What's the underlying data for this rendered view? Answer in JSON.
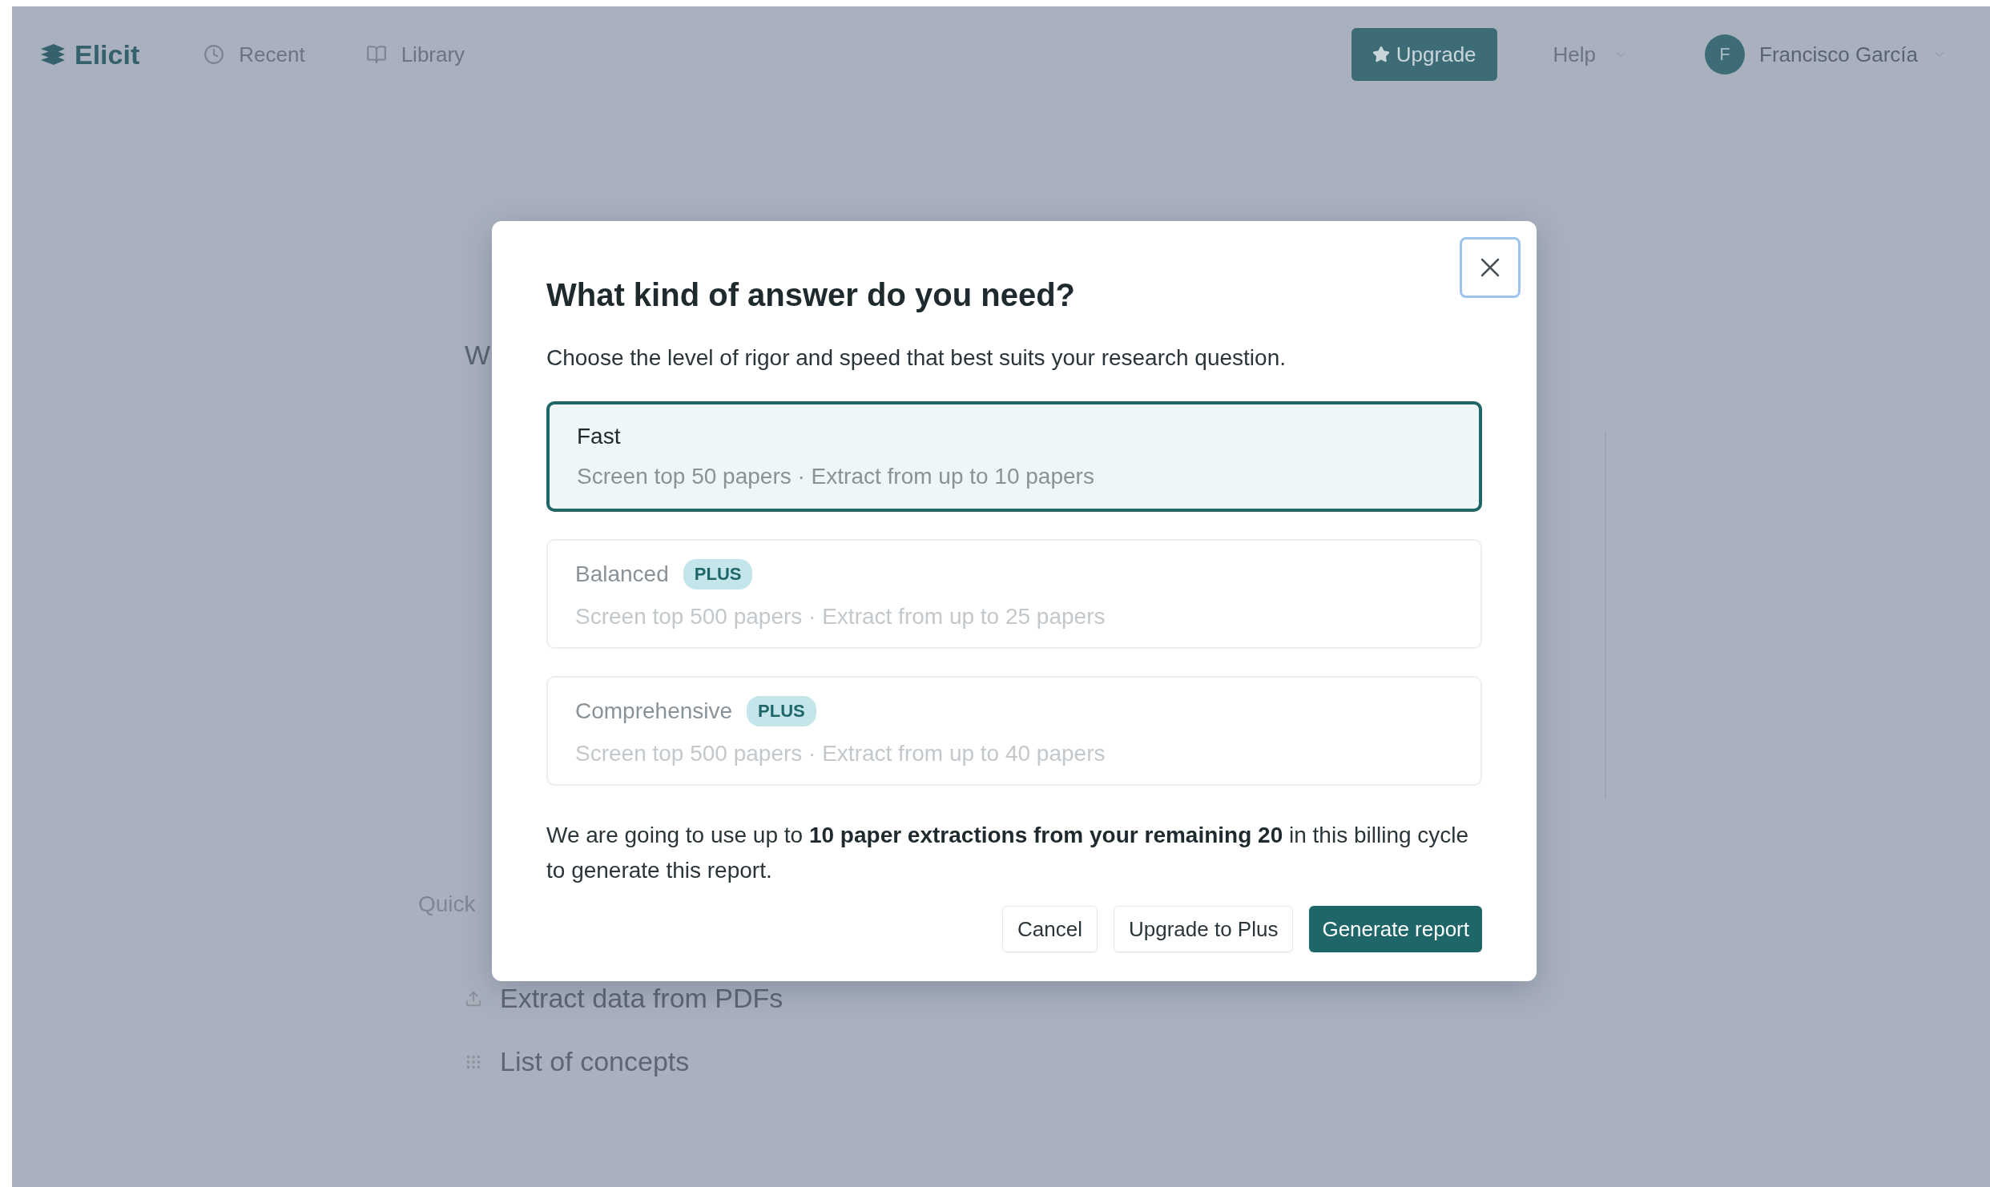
{
  "nav": {
    "logo": "Elicit",
    "links": [
      {
        "label": "Recent"
      },
      {
        "label": "Library"
      }
    ],
    "upgrade": "Upgrade",
    "help": "Help",
    "user": {
      "initial": "F",
      "name": "Francisco García"
    }
  },
  "background": {
    "fragment": "W",
    "section_label": "Quick",
    "items": [
      {
        "label": "Extract data from PDFs"
      },
      {
        "label": "List of concepts"
      }
    ]
  },
  "dialog": {
    "title": "What kind of answer do you need?",
    "subtitle": "Choose the level of rigor and speed that best suits your research question.",
    "options": [
      {
        "name": "Fast",
        "detail": "Screen top 50 papers · Extract from up to 10 papers",
        "selected": true,
        "disabled": false
      },
      {
        "name": "Balanced",
        "badge": "PLUS",
        "detail": "Screen top 500 papers · Extract from up to 25 papers",
        "selected": false,
        "disabled": true
      },
      {
        "name": "Comprehensive",
        "badge": "PLUS",
        "detail": "Screen top 500 papers · Extract from up to 40 papers",
        "selected": false,
        "disabled": true
      }
    ],
    "notice": "We are going to use up to **10 paper extractions from your remaining 20** in this billing cycle to generate this report.",
    "buttons": [
      {
        "label": "Cancel",
        "kind": "secondary"
      },
      {
        "label": "Upgrade to Plus",
        "kind": "secondary"
      },
      {
        "label": "Generate report",
        "kind": "primary"
      }
    ]
  }
}
